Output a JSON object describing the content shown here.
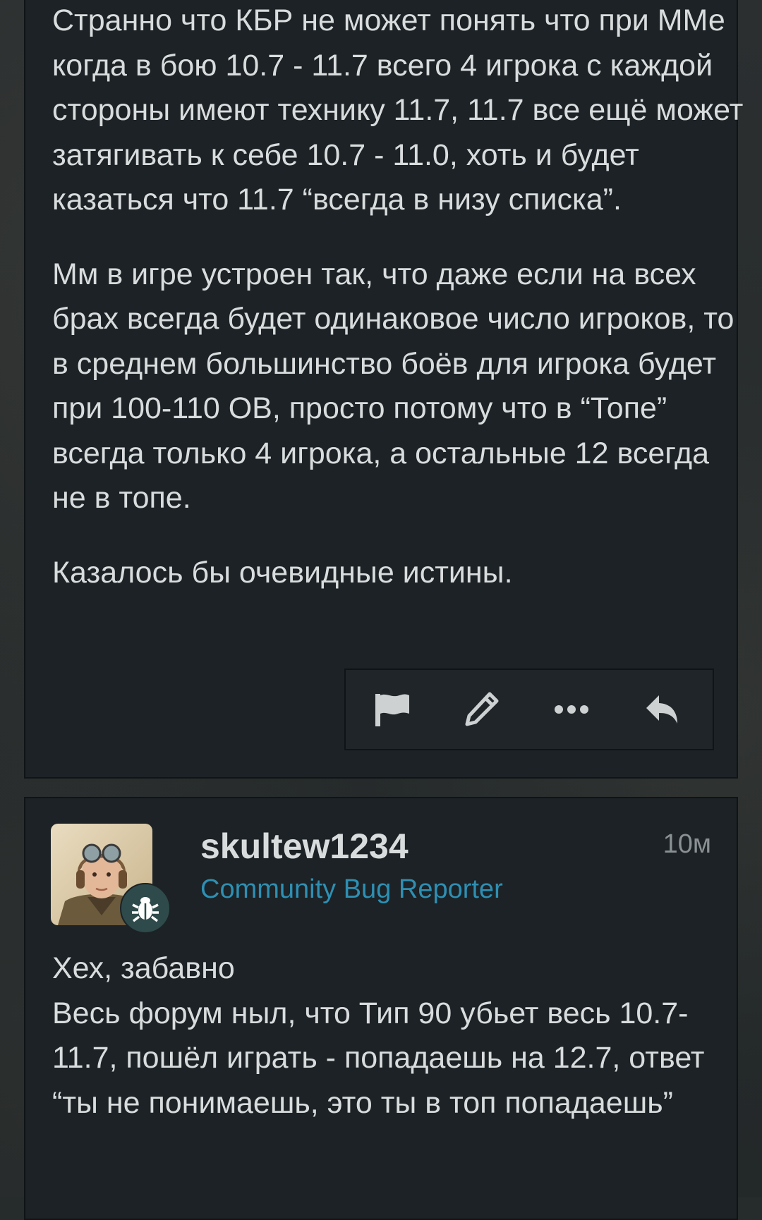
{
  "post_1": {
    "paragraphs": [
      "Странно что КБР не может понять что при ММе когда в бою 10.7 - 11.7 всего 4 игрока с каждой стороны имеют технику 11.7, 11.7 все ещё может затягивать к себе 10.7 - 11.0, хоть и будет казаться что 11.7 “всегда в низу списка”.",
      "Мм в игре устроен так, что даже если на всех брах всегда будет одинаковое число игроков, то в среднем большинство боёв для игрока будет при 100-110 ОВ, просто потому что в “Топе” всегда только 4 игрока, а остальные 12 всегда не в топе.",
      "Казалось бы очевидные истины."
    ],
    "actions": {
      "flag_icon": "flag-icon",
      "edit_icon": "pencil-icon",
      "more_icon": "ellipsis-icon",
      "reply_icon": "reply-icon"
    }
  },
  "post_2": {
    "username": "skultew1234",
    "user_title": "Community Bug Reporter",
    "time": "10м",
    "badge_icon": "bug-icon",
    "lines": [
      "Хех, забавно",
      "Весь форум ныл, что Тип 90 убьет весь 10.7-11.7, пошёл играть - попадаешь на 12.7, ответ “ты не понимаешь, это ты в топ попадаешь”"
    ]
  },
  "colors": {
    "post_background": "#1c2225",
    "text": "#d9dcdd",
    "user_title": "#2e8fb3",
    "muted": "#8a9193",
    "badge": "#2f4a4a"
  }
}
